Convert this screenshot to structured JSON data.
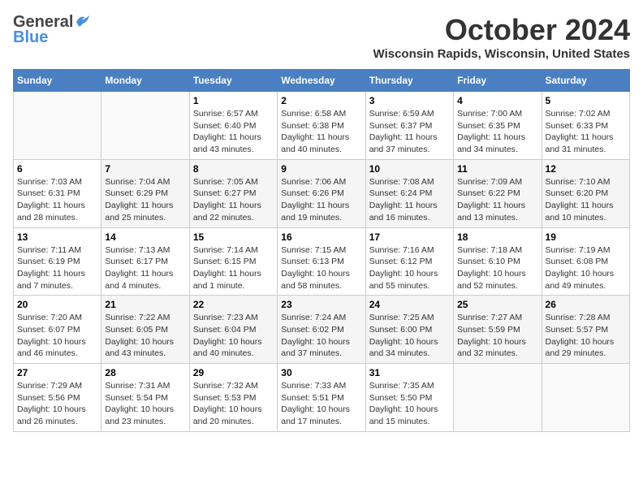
{
  "header": {
    "logo_general": "General",
    "logo_blue": "Blue",
    "month": "October 2024",
    "location": "Wisconsin Rapids, Wisconsin, United States"
  },
  "weekdays": [
    "Sunday",
    "Monday",
    "Tuesday",
    "Wednesday",
    "Thursday",
    "Friday",
    "Saturday"
  ],
  "weeks": [
    [
      {
        "day": "",
        "info": ""
      },
      {
        "day": "",
        "info": ""
      },
      {
        "day": "1",
        "info": "Sunrise: 6:57 AM\nSunset: 6:40 PM\nDaylight: 11 hours and 43 minutes."
      },
      {
        "day": "2",
        "info": "Sunrise: 6:58 AM\nSunset: 6:38 PM\nDaylight: 11 hours and 40 minutes."
      },
      {
        "day": "3",
        "info": "Sunrise: 6:59 AM\nSunset: 6:37 PM\nDaylight: 11 hours and 37 minutes."
      },
      {
        "day": "4",
        "info": "Sunrise: 7:00 AM\nSunset: 6:35 PM\nDaylight: 11 hours and 34 minutes."
      },
      {
        "day": "5",
        "info": "Sunrise: 7:02 AM\nSunset: 6:33 PM\nDaylight: 11 hours and 31 minutes."
      }
    ],
    [
      {
        "day": "6",
        "info": "Sunrise: 7:03 AM\nSunset: 6:31 PM\nDaylight: 11 hours and 28 minutes."
      },
      {
        "day": "7",
        "info": "Sunrise: 7:04 AM\nSunset: 6:29 PM\nDaylight: 11 hours and 25 minutes."
      },
      {
        "day": "8",
        "info": "Sunrise: 7:05 AM\nSunset: 6:27 PM\nDaylight: 11 hours and 22 minutes."
      },
      {
        "day": "9",
        "info": "Sunrise: 7:06 AM\nSunset: 6:26 PM\nDaylight: 11 hours and 19 minutes."
      },
      {
        "day": "10",
        "info": "Sunrise: 7:08 AM\nSunset: 6:24 PM\nDaylight: 11 hours and 16 minutes."
      },
      {
        "day": "11",
        "info": "Sunrise: 7:09 AM\nSunset: 6:22 PM\nDaylight: 11 hours and 13 minutes."
      },
      {
        "day": "12",
        "info": "Sunrise: 7:10 AM\nSunset: 6:20 PM\nDaylight: 11 hours and 10 minutes."
      }
    ],
    [
      {
        "day": "13",
        "info": "Sunrise: 7:11 AM\nSunset: 6:19 PM\nDaylight: 11 hours and 7 minutes."
      },
      {
        "day": "14",
        "info": "Sunrise: 7:13 AM\nSunset: 6:17 PM\nDaylight: 11 hours and 4 minutes."
      },
      {
        "day": "15",
        "info": "Sunrise: 7:14 AM\nSunset: 6:15 PM\nDaylight: 11 hours and 1 minute."
      },
      {
        "day": "16",
        "info": "Sunrise: 7:15 AM\nSunset: 6:13 PM\nDaylight: 10 hours and 58 minutes."
      },
      {
        "day": "17",
        "info": "Sunrise: 7:16 AM\nSunset: 6:12 PM\nDaylight: 10 hours and 55 minutes."
      },
      {
        "day": "18",
        "info": "Sunrise: 7:18 AM\nSunset: 6:10 PM\nDaylight: 10 hours and 52 minutes."
      },
      {
        "day": "19",
        "info": "Sunrise: 7:19 AM\nSunset: 6:08 PM\nDaylight: 10 hours and 49 minutes."
      }
    ],
    [
      {
        "day": "20",
        "info": "Sunrise: 7:20 AM\nSunset: 6:07 PM\nDaylight: 10 hours and 46 minutes."
      },
      {
        "day": "21",
        "info": "Sunrise: 7:22 AM\nSunset: 6:05 PM\nDaylight: 10 hours and 43 minutes."
      },
      {
        "day": "22",
        "info": "Sunrise: 7:23 AM\nSunset: 6:04 PM\nDaylight: 10 hours and 40 minutes."
      },
      {
        "day": "23",
        "info": "Sunrise: 7:24 AM\nSunset: 6:02 PM\nDaylight: 10 hours and 37 minutes."
      },
      {
        "day": "24",
        "info": "Sunrise: 7:25 AM\nSunset: 6:00 PM\nDaylight: 10 hours and 34 minutes."
      },
      {
        "day": "25",
        "info": "Sunrise: 7:27 AM\nSunset: 5:59 PM\nDaylight: 10 hours and 32 minutes."
      },
      {
        "day": "26",
        "info": "Sunrise: 7:28 AM\nSunset: 5:57 PM\nDaylight: 10 hours and 29 minutes."
      }
    ],
    [
      {
        "day": "27",
        "info": "Sunrise: 7:29 AM\nSunset: 5:56 PM\nDaylight: 10 hours and 26 minutes."
      },
      {
        "day": "28",
        "info": "Sunrise: 7:31 AM\nSunset: 5:54 PM\nDaylight: 10 hours and 23 minutes."
      },
      {
        "day": "29",
        "info": "Sunrise: 7:32 AM\nSunset: 5:53 PM\nDaylight: 10 hours and 20 minutes."
      },
      {
        "day": "30",
        "info": "Sunrise: 7:33 AM\nSunset: 5:51 PM\nDaylight: 10 hours and 17 minutes."
      },
      {
        "day": "31",
        "info": "Sunrise: 7:35 AM\nSunset: 5:50 PM\nDaylight: 10 hours and 15 minutes."
      },
      {
        "day": "",
        "info": ""
      },
      {
        "day": "",
        "info": ""
      }
    ]
  ]
}
